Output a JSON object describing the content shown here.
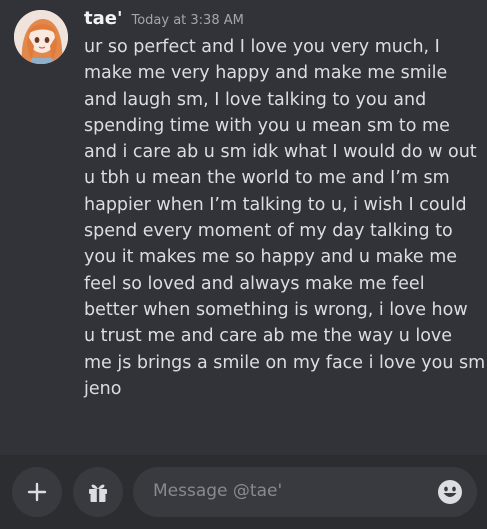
{
  "message": {
    "author": "tae'",
    "timestamp": "Today at 3:38 AM",
    "lines": [
      "ur so perfect and I love you very much, I",
      "make me very happy and make me smile",
      "and laugh sm, I love talking to you and",
      "spending time with you u mean sm to me",
      "and i care ab u sm idk what I would do w out",
      "u tbh u mean the world to me and I’m sm",
      "happier when I’m talking to u, i wish I could",
      "spend every moment of my day talking to",
      "you it makes me so happy and u make me",
      "feel so loved and always make me feel",
      "better when something is wrong, i love how",
      "u trust me and care ab me the way u love",
      "me js brings a smile on my face i love you sm",
      "jeno"
    ]
  },
  "composer": {
    "placeholder": "Message @tae'",
    "buttons": [
      {
        "icon": "plus-icon"
      },
      {
        "icon": "gift-icon"
      },
      {
        "icon": "smiley-emoji-icon"
      }
    ]
  },
  "colors": {
    "background": "#313338",
    "composer_bar": "#2b2d31",
    "input": "#383a40",
    "author": "#f2f3f5",
    "text": "#dbdee1",
    "muted": "#a3a6aa"
  }
}
